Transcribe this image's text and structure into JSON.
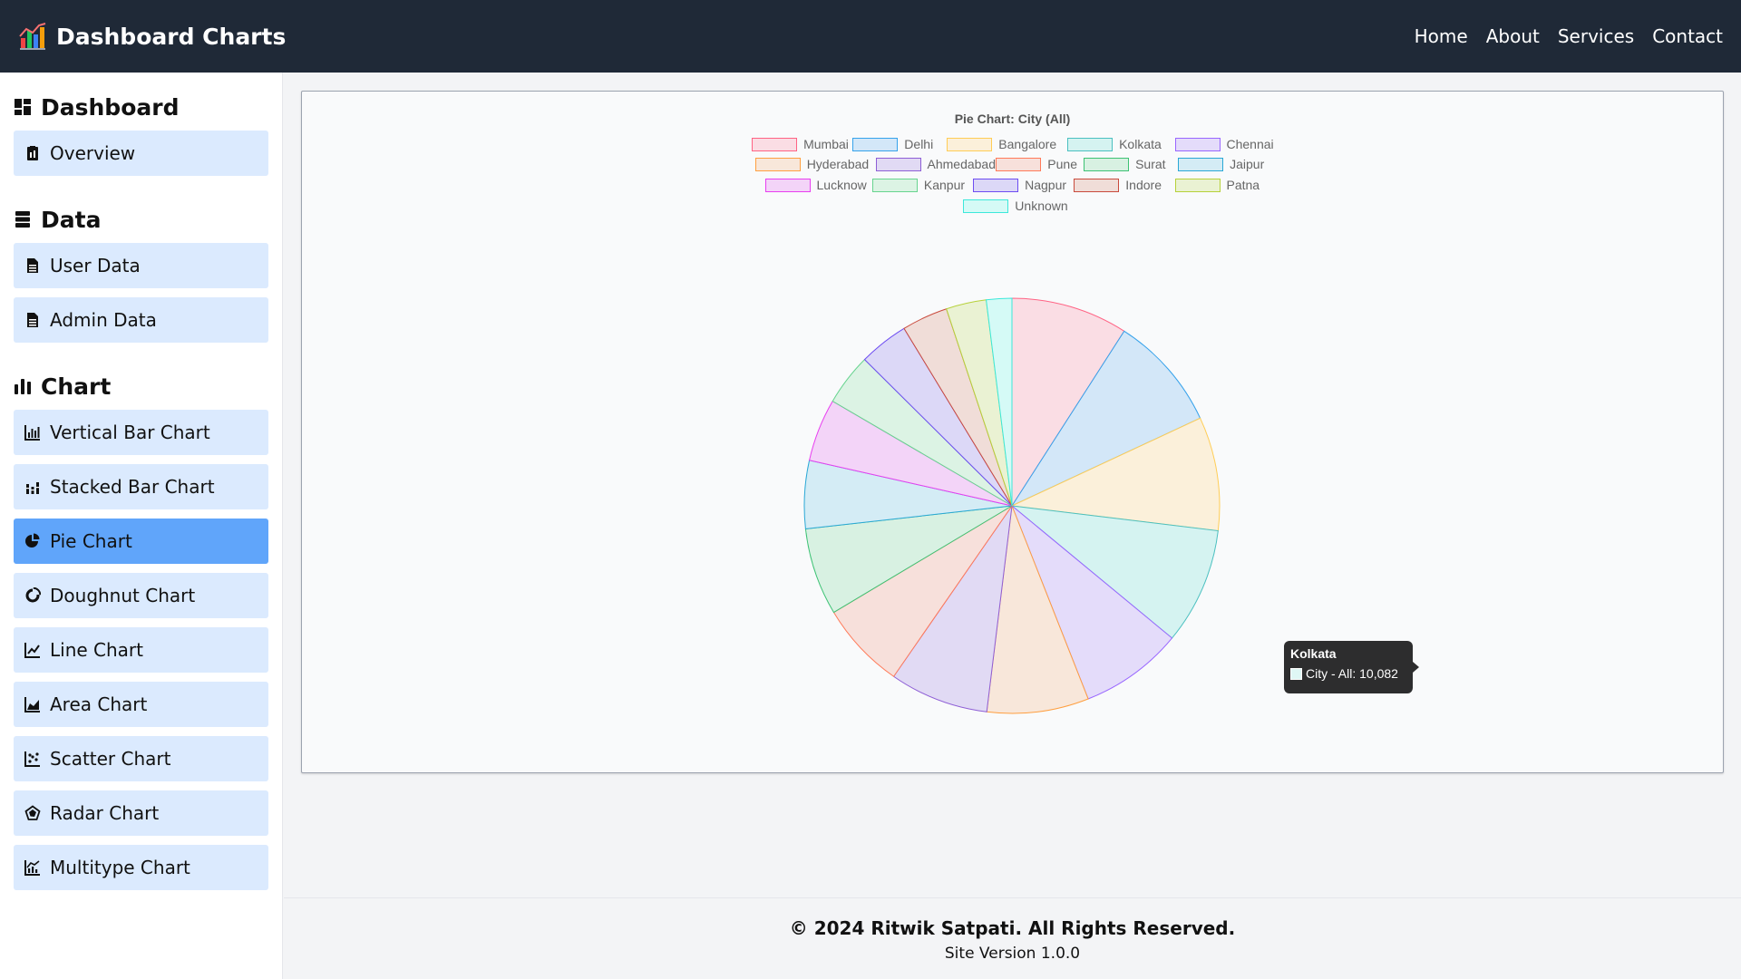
{
  "app": {
    "title": "Dashboard Charts"
  },
  "nav": {
    "links": [
      "Home",
      "About",
      "Services",
      "Contact"
    ]
  },
  "sidebar": {
    "sections": [
      {
        "title": "Dashboard",
        "icon": "dashboard-icon",
        "items": [
          {
            "label": "Overview",
            "icon": "clipboard-icon"
          }
        ]
      },
      {
        "title": "Data",
        "icon": "database-icon",
        "items": [
          {
            "label": "User Data",
            "icon": "file-table-icon"
          },
          {
            "label": "Admin Data",
            "icon": "file-table-icon"
          }
        ]
      },
      {
        "title": "Chart",
        "icon": "bar-chart-icon",
        "items": [
          {
            "label": "Vertical Bar Chart",
            "icon": "vertical-bar-icon"
          },
          {
            "label": "Stacked Bar Chart",
            "icon": "stacked-bar-icon"
          },
          {
            "label": "Pie Chart",
            "icon": "pie-icon",
            "active": true
          },
          {
            "label": "Doughnut Chart",
            "icon": "doughnut-icon"
          },
          {
            "label": "Line Chart",
            "icon": "line-chart-icon"
          },
          {
            "label": "Area Chart",
            "icon": "area-chart-icon"
          },
          {
            "label": "Scatter Chart",
            "icon": "scatter-icon"
          },
          {
            "label": "Radar Chart",
            "icon": "radar-icon"
          },
          {
            "label": "Multitype Chart",
            "icon": "multitype-icon"
          }
        ]
      }
    ]
  },
  "chart_data": {
    "type": "pie",
    "title": "Pie Chart: City (All)",
    "series_name": "City - All",
    "legend_position": "top",
    "categories": [
      "Mumbai",
      "Delhi",
      "Bangalore",
      "Kolkata",
      "Chennai",
      "Hyderabad",
      "Ahmedabad",
      "Pune",
      "Surat",
      "Jaipur",
      "Lucknow",
      "Kanpur",
      "Nagpur",
      "Indore",
      "Patna",
      "Unknown"
    ],
    "values": [
      10095,
      9970,
      9840,
      10082,
      8910,
      8800,
      8560,
      7530,
      7560,
      5880,
      5425,
      4485,
      4290,
      3980,
      3480,
      2200
    ],
    "fill_colors": [
      "#fadde4",
      "#d3e7f8",
      "#fbf0da",
      "#d5f3f1",
      "#e4dcfa",
      "#f8e7da",
      "#e1daf4",
      "#f7e0db",
      "#d8f1e2",
      "#d4ecf5",
      "#f3d4f8",
      "#dcf3e4",
      "#dcd8f7",
      "#f0ddd8",
      "#eaf2d3",
      "#d5faf6"
    ],
    "border_colors": [
      "#ff6384",
      "#36a2eb",
      "#ffcd56",
      "#4bc0c0",
      "#9966ff",
      "#ff9f40",
      "#8e5ed6",
      "#ff7a59",
      "#3dc274",
      "#2aa8d6",
      "#e83ef0",
      "#67d48f",
      "#6d4cf2",
      "#c94a3c",
      "#b6d13a",
      "#3ce8da"
    ]
  },
  "tooltip": {
    "title": "Kolkata",
    "label": "City - All: 10,082"
  },
  "footer": {
    "copyright": "© 2024 Ritwik Satpati. All Rights Reserved.",
    "version": "Site Version 1.0.0"
  }
}
